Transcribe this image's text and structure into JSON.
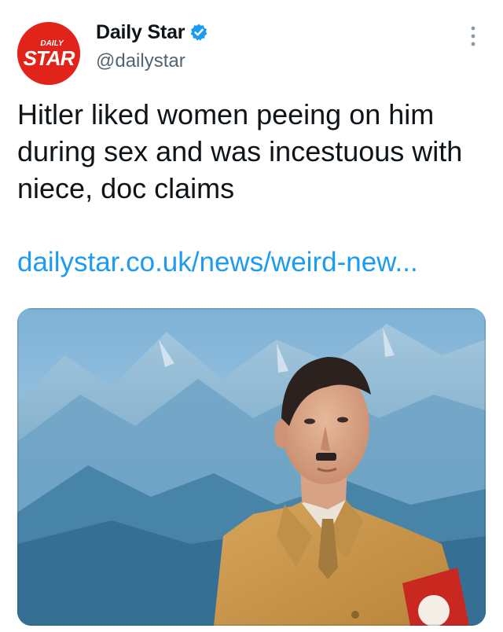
{
  "account": {
    "display_name": "Daily Star",
    "handle": "@dailystar",
    "verified": true,
    "avatar_icon": "daily-star-logo",
    "logo_text_top": "DAILY",
    "logo_text_main": "STAR",
    "logo_color": "#e2231a"
  },
  "tweet": {
    "text": "Hitler liked women peeing on him during sex and was incestuous with niece, doc claims",
    "link_text": "dailystar.co.uk/news/weird-new...",
    "link_color": "#1d9bf0"
  },
  "icons": {
    "verified": "verified-badge-icon",
    "more": "more-options-icon"
  },
  "colors": {
    "text": "#0f1419",
    "secondary": "#536471",
    "verified": "#1d9bf0"
  }
}
